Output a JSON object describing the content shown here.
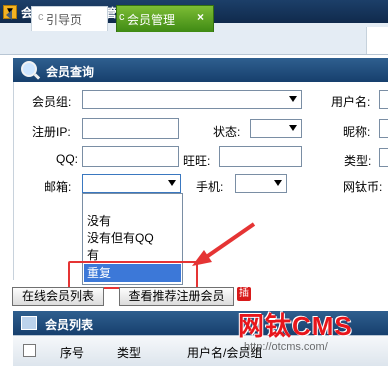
{
  "titlebar": {
    "icon": "down-arrow-icon",
    "title": "会员管理→会员管理"
  },
  "tabs": [
    {
      "label": "引导页",
      "icon": "refresh-icon"
    },
    {
      "label": "会员管理",
      "icon": "refresh-icon",
      "close": "×"
    }
  ],
  "query_panel": {
    "title": "会员查询",
    "labels": {
      "member_group": "会员组:",
      "username": "用户名:",
      "register_ip": "注册IP:",
      "status": "状态:",
      "nickname": "昵称:",
      "qq": "QQ:",
      "wangwang": "旺旺:",
      "type": "类型:",
      "email": "邮箱:",
      "phone": "手机:",
      "coins": "网钛币:"
    },
    "email_dropdown_options": [
      "没有",
      "没有但有QQ",
      "有",
      "重复"
    ],
    "email_selected_option": "重复",
    "buttons": {
      "online_list": "在线会员列表",
      "view_referrals": "查看推荐注册会员",
      "badge": "插"
    }
  },
  "list_panel": {
    "title": "会员列表",
    "columns": [
      "序号",
      "类型",
      "用户名/会员组"
    ]
  },
  "watermark": {
    "brand": "网钛CMS",
    "url": "http://otcms.com/"
  },
  "colors": {
    "header_blue": "#173f6d",
    "active_tab_green": "#3f8a14",
    "highlight_red": "#e53434",
    "selection_blue": "#3c78d8"
  }
}
